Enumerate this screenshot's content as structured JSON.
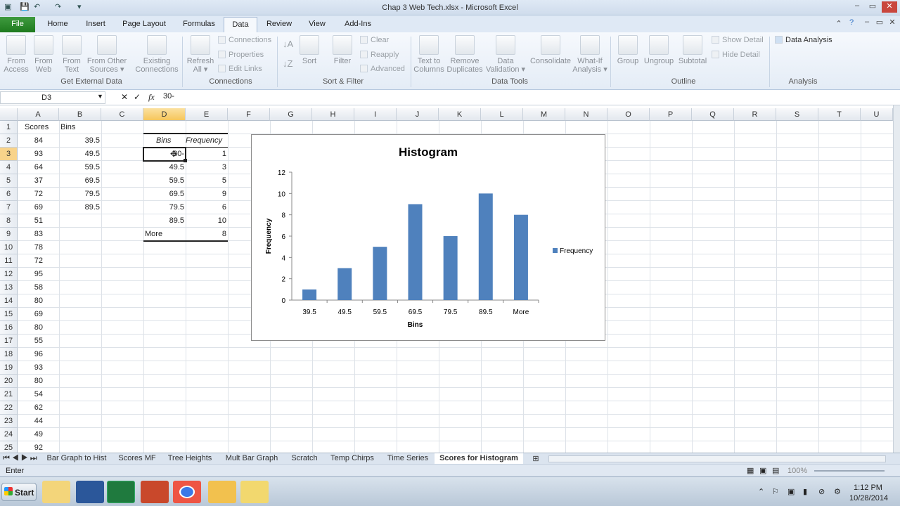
{
  "window": {
    "title": "Chap 3 Web Tech.xlsx - Microsoft Excel"
  },
  "tabs": [
    "File",
    "Home",
    "Insert",
    "Page Layout",
    "Formulas",
    "Data",
    "Review",
    "View",
    "Add-Ins"
  ],
  "ribbon": {
    "get_external": {
      "buttons": [
        [
          "From",
          "Access"
        ],
        [
          "From",
          "Web"
        ],
        [
          "From",
          "Text"
        ],
        [
          "From Other",
          "Sources ▾"
        ],
        [
          "Existing",
          "Connections"
        ]
      ],
      "label": "Get External Data"
    },
    "connections": {
      "refresh": [
        "Refresh",
        "All ▾"
      ],
      "items": [
        "Connections",
        "Properties",
        "Edit Links"
      ],
      "label": "Connections"
    },
    "sort_filter": {
      "sort": "Sort",
      "filter": "Filter",
      "items": [
        "Clear",
        "Reapply",
        "Advanced"
      ],
      "label": "Sort & Filter"
    },
    "data_tools": {
      "buttons": [
        [
          "Text to",
          "Columns"
        ],
        [
          "Remove",
          "Duplicates"
        ],
        [
          "Data",
          "Validation ▾"
        ],
        [
          "Consolidate",
          ""
        ],
        [
          "What-If",
          "Analysis ▾"
        ]
      ],
      "label": "Data Tools"
    },
    "outline": {
      "buttons": [
        "Group",
        "Ungroup",
        "Subtotal"
      ],
      "items": [
        "Show Detail",
        "Hide Detail"
      ],
      "label": "Outline"
    },
    "analysis": {
      "button": "Data Analysis",
      "label": "Analysis"
    }
  },
  "formula_bar": {
    "name_box": "D3",
    "fx": "fx",
    "value": "30-"
  },
  "grid": {
    "columns": [
      "A",
      "B",
      "C",
      "D",
      "E",
      "F",
      "G",
      "H",
      "I",
      "J",
      "K",
      "L",
      "M",
      "N",
      "O",
      "P",
      "Q",
      "R",
      "S",
      "T",
      "U"
    ],
    "rows": [
      "1",
      "2",
      "3",
      "4",
      "5",
      "6",
      "7",
      "8",
      "9",
      "10",
      "11",
      "12",
      "13",
      "14",
      "15",
      "16",
      "17",
      "18",
      "19",
      "20",
      "21",
      "22",
      "23",
      "24",
      "25"
    ],
    "col_a_header": "Scores",
    "col_b_header": "Bins",
    "scores": [
      "84",
      "93",
      "64",
      "37",
      "72",
      "69",
      "51",
      "83",
      "78",
      "72",
      "95",
      "58",
      "80",
      "69",
      "80",
      "55",
      "96",
      "93",
      "80",
      "54",
      "62",
      "44",
      "49",
      "92"
    ],
    "bins": [
      "39.5",
      "49.5",
      "59.5",
      "69.5",
      "79.5",
      "89.5"
    ],
    "table_header": {
      "bins": "Bins",
      "frequency": "Frequency"
    },
    "table_bins": [
      "30-",
      "49.5",
      "59.5",
      "69.5",
      "79.5",
      "89.5",
      "More"
    ],
    "table_freq": [
      "1",
      "3",
      "5",
      "9",
      "6",
      "10",
      "8"
    ]
  },
  "chart_data": {
    "type": "bar",
    "title": "Histogram",
    "categories": [
      "39.5",
      "49.5",
      "59.5",
      "69.5",
      "79.5",
      "89.5",
      "More"
    ],
    "series": [
      {
        "name": "Frequency",
        "values": [
          1,
          3,
          5,
          9,
          6,
          10,
          8
        ],
        "color": "#4f81bd"
      }
    ],
    "xlabel": "Bins",
    "ylabel": "Frequency",
    "ylim": [
      0,
      12
    ],
    "yticks": [
      "0",
      "2",
      "4",
      "6",
      "8",
      "10",
      "12"
    ],
    "legend": "right",
    "grid": false
  },
  "sheets": [
    "Bar Graph to Hist",
    "Scores MF",
    "Tree Heights",
    "Mult Bar Graph",
    "Scratch",
    "Temp Chirps",
    "Time Series",
    "Scores for Histogram"
  ],
  "status": {
    "mode": "Enter",
    "zoom": "100%"
  },
  "taskbar": {
    "start": "Start",
    "time": "1:12 PM",
    "date": "10/28/2014"
  }
}
